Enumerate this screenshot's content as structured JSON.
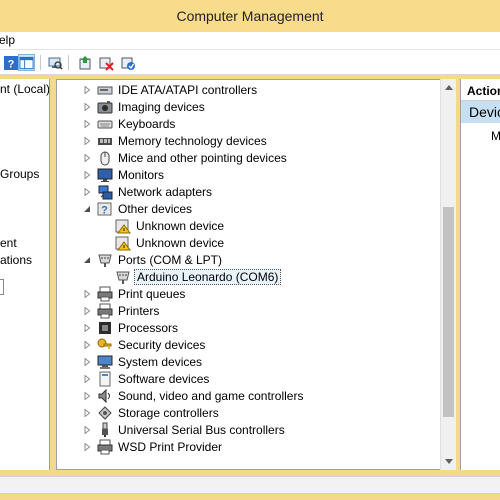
{
  "window": {
    "title": "Computer Management"
  },
  "menubar": {
    "help_label": "elp"
  },
  "toolbar": {
    "buttons": [
      {
        "icon": "help-icon"
      },
      {
        "icon": "show-hide-tree-icon"
      },
      {
        "icon": "scan-hardware-icon"
      },
      {
        "icon": "update-driver-icon"
      },
      {
        "icon": "uninstall-icon"
      },
      {
        "icon": "enable-device-icon"
      }
    ]
  },
  "left_tree": {
    "items": [
      {
        "label": "nt (Local)"
      },
      {
        "label": "Groups"
      },
      {
        "label": "ent"
      },
      {
        "label": "ations"
      }
    ]
  },
  "device_tree": {
    "items": [
      {
        "label": "IDE ATA/ATAPI controllers",
        "icon": "ide-controller-icon",
        "expanded": false,
        "level": 0
      },
      {
        "label": "Imaging devices",
        "icon": "camera-icon",
        "expanded": false,
        "level": 0
      },
      {
        "label": "Keyboards",
        "icon": "keyboard-icon",
        "expanded": false,
        "level": 0
      },
      {
        "label": "Memory technology devices",
        "icon": "memory-icon",
        "expanded": false,
        "level": 0
      },
      {
        "label": "Mice and other pointing devices",
        "icon": "mouse-icon",
        "expanded": false,
        "level": 0
      },
      {
        "label": "Monitors",
        "icon": "monitor-icon",
        "expanded": false,
        "level": 0
      },
      {
        "label": "Network adapters",
        "icon": "network-icon",
        "expanded": false,
        "level": 0
      },
      {
        "label": "Other devices",
        "icon": "unknown-device-icon",
        "expanded": true,
        "level": 0
      },
      {
        "label": "Unknown device",
        "icon": "warning-device-icon",
        "level": 1
      },
      {
        "label": "Unknown device",
        "icon": "warning-device-icon",
        "level": 1
      },
      {
        "label": "Ports (COM & LPT)",
        "icon": "port-icon",
        "expanded": true,
        "level": 0
      },
      {
        "label": "Arduino Leonardo (COM6)",
        "icon": "port-icon",
        "level": 1,
        "selected": true
      },
      {
        "label": "Print queues",
        "icon": "printer-icon",
        "expanded": false,
        "level": 0
      },
      {
        "label": "Printers",
        "icon": "printer-icon",
        "expanded": false,
        "level": 0
      },
      {
        "label": "Processors",
        "icon": "processor-icon",
        "expanded": false,
        "level": 0
      },
      {
        "label": "Security devices",
        "icon": "key-icon",
        "expanded": false,
        "level": 0
      },
      {
        "label": "System devices",
        "icon": "computer-icon",
        "expanded": false,
        "level": 0
      },
      {
        "label": "Software devices",
        "icon": "software-device-icon",
        "expanded": false,
        "level": 0
      },
      {
        "label": "Sound, video and game controllers",
        "icon": "speaker-icon",
        "expanded": false,
        "level": 0
      },
      {
        "label": "Storage controllers",
        "icon": "storage-icon",
        "expanded": false,
        "level": 0
      },
      {
        "label": "Universal Serial Bus controllers",
        "icon": "usb-icon",
        "expanded": false,
        "level": 0
      },
      {
        "label": "WSD Print Provider",
        "icon": "printer-icon",
        "expanded": false,
        "level": 0
      }
    ]
  },
  "actions": {
    "header": "Actions",
    "section": "Device Manager",
    "more": "More Actions"
  }
}
